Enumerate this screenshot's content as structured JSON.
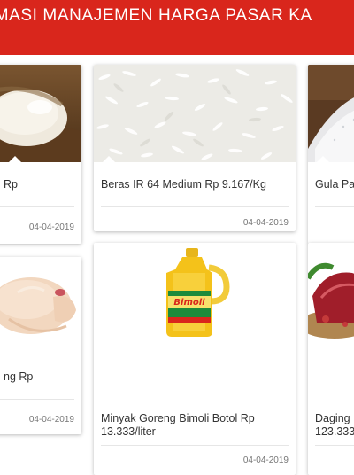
{
  "header": {
    "title": "ORMASI MANAJEMEN HARGA PASAR KA"
  },
  "products": [
    {
      "name": "Rp",
      "date": "04-04-2019",
      "image": "rice-bowl-image"
    },
    {
      "name": "Beras IR 64 Medium Rp 9.167/Kg",
      "date": "04-04-2019",
      "image": "rice-grains-image"
    },
    {
      "name": "Gula Pa",
      "date": "",
      "image": "sugar-image"
    },
    {
      "name": "ng Rp",
      "date": "04-04-2019",
      "image": "chicken-image"
    },
    {
      "name": "Minyak Goreng Bimoli Botol Rp 13.333/liter",
      "date": "04-04-2019",
      "image": "cooking-oil-bottle-image"
    },
    {
      "name": "Daging 123.333",
      "date": "",
      "image": "beef-image"
    }
  ],
  "colors": {
    "header_bg": "#d9261c",
    "header_text": "#ffffff",
    "card_text": "#333333",
    "date_text": "#777777"
  }
}
